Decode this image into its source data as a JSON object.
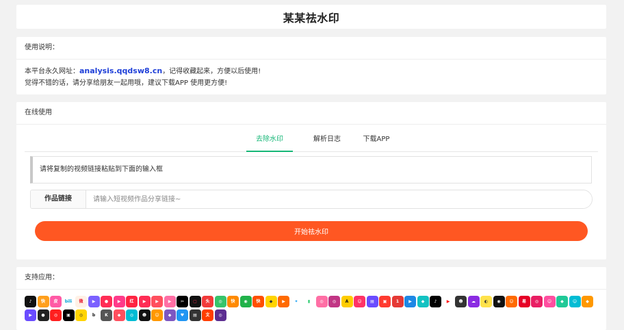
{
  "header": {
    "title": "某某祛水印"
  },
  "usage": {
    "heading": "使用说明：",
    "line1_prefix": "本平台永久网址：",
    "url": "analysis.qqdsw8.cn",
    "line1_suffix": "，记得收藏起来，方便以后使用!",
    "line2": "觉得不错的话，请分享给朋友一起用哦，建议下载APP 使用更方便!"
  },
  "online": {
    "heading": "在线使用",
    "tabs": [
      {
        "label": "去除水印",
        "active": true
      },
      {
        "label": "解析日志",
        "active": false
      },
      {
        "label": "下载APP",
        "active": false
      }
    ],
    "notice": "请将复制的视频链接粘贴到下面的输入框",
    "field_label": "作品链接",
    "input_placeholder": "请输入短视频作品分享链接~",
    "input_value": "",
    "button_label": "开始祛水印"
  },
  "apps": {
    "heading": "支持应用：",
    "icons": [
      {
        "name": "douyin",
        "bg": "#111111",
        "fg": "#ffffff",
        "glyph": "♪"
      },
      {
        "name": "kuaiyin",
        "bg": "#ff9f1c",
        "fg": "#ffffff",
        "glyph": "快"
      },
      {
        "name": "pipixia",
        "bg": "#ff5aa5",
        "fg": "#ffffff",
        "glyph": "皮"
      },
      {
        "name": "bilibili",
        "bg": "#ffffff",
        "fg": "#00a1d6",
        "glyph": "bili"
      },
      {
        "name": "weibo",
        "bg": "#fff1e6",
        "fg": "#e6162d",
        "glyph": "微"
      },
      {
        "name": "video-a",
        "bg": "#7b61ff",
        "fg": "#ffffff",
        "glyph": "▶"
      },
      {
        "name": "video-b",
        "bg": "#ff2d55",
        "fg": "#ffffff",
        "glyph": "●"
      },
      {
        "name": "video-c",
        "bg": "#ff3b8a",
        "fg": "#ffffff",
        "glyph": "▶"
      },
      {
        "name": "xiaohongshu",
        "bg": "#ff2442",
        "fg": "#ffffff",
        "glyph": "红"
      },
      {
        "name": "video-d",
        "bg": "#ff2d55",
        "fg": "#ffffff",
        "glyph": "▶"
      },
      {
        "name": "video-e",
        "bg": "#ff4f5e",
        "fg": "#ffffff",
        "glyph": "▶"
      },
      {
        "name": "video-f",
        "bg": "#ff6fa5",
        "fg": "#ffffff",
        "glyph": "▶"
      },
      {
        "name": "capcut",
        "bg": "#000000",
        "fg": "#ffffff",
        "glyph": "✂"
      },
      {
        "name": "video-g",
        "bg": "#111111",
        "fg": "#ff2d55",
        "glyph": "▢"
      },
      {
        "name": "toutiao",
        "bg": "#f23a3a",
        "fg": "#ffffff",
        "glyph": "头"
      },
      {
        "name": "video-h",
        "bg": "#37c46b",
        "fg": "#ffffff",
        "glyph": "◎"
      },
      {
        "name": "kuaishou",
        "bg": "#ff8a00",
        "fg": "#ffffff",
        "glyph": "快"
      },
      {
        "name": "app-green",
        "bg": "#21b24a",
        "fg": "#ffffff",
        "glyph": "◉"
      },
      {
        "name": "kuaishou-lite",
        "bg": "#ff4f00",
        "fg": "#ffffff",
        "glyph": "快"
      },
      {
        "name": "app-yellow",
        "bg": "#ffd400",
        "fg": "#333333",
        "glyph": "◆"
      },
      {
        "name": "video-i",
        "bg": "#ff6a00",
        "fg": "#ffffff",
        "glyph": "▶"
      },
      {
        "name": "twitter",
        "bg": "#ffffff",
        "fg": "#1da1f2",
        "glyph": "✦"
      },
      {
        "name": "app-chart",
        "bg": "#ffffff",
        "fg": "#2ecc71",
        "glyph": "▮"
      },
      {
        "name": "app-pink",
        "bg": "#ff6fa5",
        "fg": "#ffffff",
        "glyph": "◎"
      },
      {
        "name": "instagram",
        "bg": "#c13584",
        "fg": "#ffffff",
        "glyph": "◎"
      },
      {
        "name": "app-a",
        "bg": "#ffcc00",
        "fg": "#111111",
        "glyph": "A"
      },
      {
        "name": "app-face",
        "bg": "#ff3366",
        "fg": "#ffffff",
        "glyph": "☺"
      },
      {
        "name": "app-purple",
        "bg": "#6a4cff",
        "fg": "#ffffff",
        "glyph": "▤"
      },
      {
        "name": "app-red",
        "bg": "#ff3b30",
        "fg": "#ffffff",
        "glyph": "▣"
      },
      {
        "name": "app-one",
        "bg": "#e53935",
        "fg": "#ffffff",
        "glyph": "1"
      },
      {
        "name": "app-blue",
        "bg": "#1e88e5",
        "fg": "#ffffff",
        "glyph": "▶"
      },
      {
        "name": "app-teal",
        "bg": "#13c2c2",
        "fg": "#ffffff",
        "glyph": "◆"
      },
      {
        "name": "tiktok",
        "bg": "#000000",
        "fg": "#ffffff",
        "glyph": "♪"
      },
      {
        "name": "youtube",
        "bg": "#ffffff",
        "fg": "#ff0000",
        "glyph": "▶"
      },
      {
        "name": "app-mask",
        "bg": "#333333",
        "fg": "#ffffff",
        "glyph": "☻"
      },
      {
        "name": "app-cloud",
        "bg": "#8a2be2",
        "fg": "#ffffff",
        "glyph": "☁"
      },
      {
        "name": "app-pear",
        "bg": "#ffe24a",
        "fg": "#333333",
        "glyph": "◐"
      },
      {
        "name": "app-eye",
        "bg": "#111111",
        "fg": "#ffffff",
        "glyph": "◉"
      },
      {
        "name": "app-smile",
        "bg": "#ff6a00",
        "fg": "#ffffff",
        "glyph": "☺"
      },
      {
        "name": "wangyi",
        "bg": "#e60026",
        "fg": "#ffffff",
        "glyph": "易"
      },
      {
        "name": "app-magenta",
        "bg": "#e91e63",
        "fg": "#ffffff",
        "glyph": "◎"
      },
      {
        "name": "app-pinkcat",
        "bg": "#ff4fa0",
        "fg": "#ffffff",
        "glyph": "☺"
      },
      {
        "name": "app-fish",
        "bg": "#20c997",
        "fg": "#ffffff",
        "glyph": "◆"
      },
      {
        "name": "app-cyan",
        "bg": "#00bcd4",
        "fg": "#ffffff",
        "glyph": "☺"
      },
      {
        "name": "app-orange",
        "bg": "#ff9800",
        "fg": "#ffffff",
        "glyph": "◆"
      },
      {
        "name": "app-violet",
        "bg": "#6a4cff",
        "fg": "#ffffff",
        "glyph": "▶"
      },
      {
        "name": "app-dark",
        "bg": "#212121",
        "fg": "#ffffff",
        "glyph": "●"
      },
      {
        "name": "app-red2",
        "bg": "#ff1f1f",
        "fg": "#ffffff",
        "glyph": "◎"
      },
      {
        "name": "app-black",
        "bg": "#000000",
        "fg": "#ffffff",
        "glyph": "▣"
      },
      {
        "name": "app-yellow2",
        "bg": "#ffd400",
        "fg": "#333333",
        "glyph": "◎"
      },
      {
        "name": "app-b",
        "bg": "#ffffff",
        "fg": "#111111",
        "glyph": "b"
      },
      {
        "name": "app-k",
        "bg": "#555555",
        "fg": "#ffffff",
        "glyph": "K"
      },
      {
        "name": "app-pink2",
        "bg": "#ff4f5e",
        "fg": "#ffffff",
        "glyph": "◆"
      },
      {
        "name": "app-grad",
        "bg": "#00bcd4",
        "fg": "#ffffff",
        "glyph": "◎"
      },
      {
        "name": "app-panda",
        "bg": "#111111",
        "fg": "#ffffff",
        "glyph": "☻"
      },
      {
        "name": "app-monkey",
        "bg": "#ff9800",
        "fg": "#ffffff",
        "glyph": "☺"
      },
      {
        "name": "app-lilac",
        "bg": "#7e57c2",
        "fg": "#ffffff",
        "glyph": "◆"
      },
      {
        "name": "app-heart",
        "bg": "#2196f3",
        "fg": "#ffffff",
        "glyph": "♥"
      },
      {
        "name": "app-dark2",
        "bg": "#333333",
        "fg": "#ffffff",
        "glyph": "▤"
      },
      {
        "name": "app-redtext",
        "bg": "#ff3d00",
        "fg": "#ffffff",
        "glyph": "文"
      },
      {
        "name": "app-last",
        "bg": "#5c2d91",
        "fg": "#ffffff",
        "glyph": "◎"
      }
    ]
  }
}
